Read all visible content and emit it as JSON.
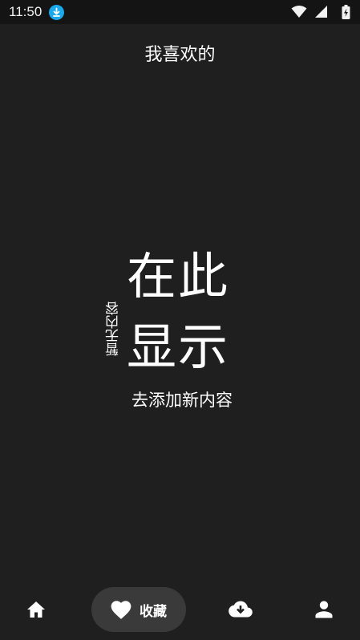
{
  "status_bar": {
    "time": "11:50",
    "icons": [
      "download-notification-icon",
      "wifi-icon",
      "cell-signal-icon",
      "battery-charging-icon"
    ]
  },
  "header": {
    "title": "我喜欢的"
  },
  "empty_state": {
    "line1": "在此",
    "line2": "显示",
    "vertical_text": "暂无内容",
    "add_link": "去添加新内容"
  },
  "bottom_nav": {
    "items": [
      {
        "icon": "home-icon",
        "label": ""
      },
      {
        "icon": "heart-icon",
        "label": "收藏",
        "active": true
      },
      {
        "icon": "cloud-download-icon",
        "label": ""
      },
      {
        "icon": "person-icon",
        "label": ""
      }
    ]
  },
  "colors": {
    "background": "#1f1f1f",
    "status_bar": "#141414",
    "active_pill": "#3a3a3a",
    "download_badge": "#19a9ec",
    "text": "#ffffff"
  }
}
